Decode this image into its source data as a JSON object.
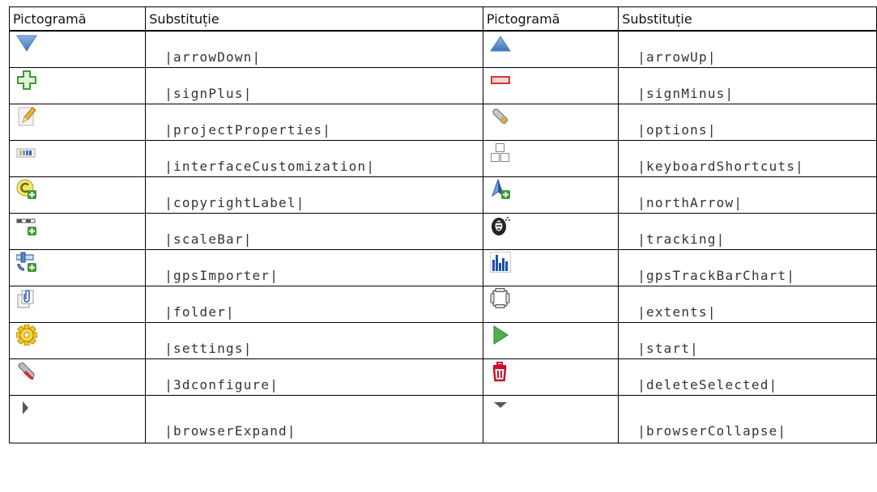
{
  "table": {
    "headers": [
      "Pictogramă",
      "Substituție",
      "Pictogramă",
      "Substituție"
    ],
    "rows": [
      {
        "left": {
          "icon": "arrow-down-icon",
          "text": "|arrowDown|"
        },
        "right": {
          "icon": "arrow-up-icon",
          "text": "|arrowUp|"
        }
      },
      {
        "left": {
          "icon": "sign-plus-icon",
          "text": "|signPlus|"
        },
        "right": {
          "icon": "sign-minus-icon",
          "text": "|signMinus|"
        }
      },
      {
        "left": {
          "icon": "project-properties-icon",
          "text": "|projectProperties|"
        },
        "right": {
          "icon": "options-icon",
          "text": "|options|"
        }
      },
      {
        "left": {
          "icon": "interface-customization-icon",
          "text": "|interfaceCustomization|"
        },
        "right": {
          "icon": "keyboard-shortcuts-icon",
          "text": "|keyboardShortcuts|"
        }
      },
      {
        "left": {
          "icon": "copyright-label-icon",
          "text": "|copyrightLabel|"
        },
        "right": {
          "icon": "north-arrow-icon",
          "text": "|northArrow|"
        }
      },
      {
        "left": {
          "icon": "scale-bar-icon",
          "text": "|scaleBar|"
        },
        "right": {
          "icon": "tracking-icon",
          "text": "|tracking|"
        }
      },
      {
        "left": {
          "icon": "gps-importer-icon",
          "text": "|gpsImporter|"
        },
        "right": {
          "icon": "gps-track-bar-chart-icon",
          "text": "|gpsTrackBarChart|"
        }
      },
      {
        "left": {
          "icon": "folder-icon",
          "text": "|folder|"
        },
        "right": {
          "icon": "extents-icon",
          "text": "|extents|"
        }
      },
      {
        "left": {
          "icon": "settings-icon",
          "text": "|settings|"
        },
        "right": {
          "icon": "start-icon",
          "text": "|start|"
        }
      },
      {
        "left": {
          "icon": "3dconfigure-icon",
          "text": "|3dconfigure|"
        },
        "right": {
          "icon": "delete-selected-icon",
          "text": "|deleteSelected|"
        }
      },
      {
        "left": {
          "icon": "browser-expand-icon",
          "text": "|browserExpand|"
        },
        "right": {
          "icon": "browser-collapse-icon",
          "text": "|browserCollapse|"
        }
      }
    ]
  }
}
